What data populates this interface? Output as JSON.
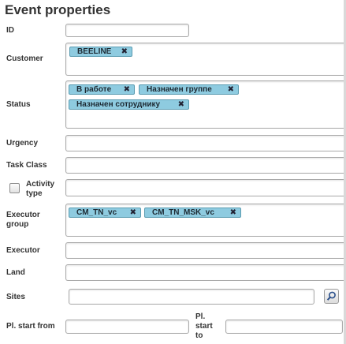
{
  "panel": {
    "title": "Event properties"
  },
  "fields": {
    "id": {
      "label": "ID",
      "value": ""
    },
    "customer": {
      "label": "Customer",
      "chips": [
        "BEELINE"
      ]
    },
    "status": {
      "label": "Status",
      "chips": [
        "В работе",
        "Назначен группе",
        "Назначен сотруднику"
      ]
    },
    "urgency": {
      "label": "Urgency",
      "value": ""
    },
    "task_class": {
      "label": "Task Class",
      "value": ""
    },
    "activity_type": {
      "label_line1": "Activity",
      "label_line2": "type",
      "checked": false,
      "value": ""
    },
    "executor_group": {
      "label_line1": "Executor",
      "label_line2": "group",
      "chips": [
        "CM_TN_vc",
        "CM_TN_MSK_vc"
      ]
    },
    "executor": {
      "label": "Executor",
      "value": ""
    },
    "land": {
      "label": "Land",
      "value": ""
    },
    "sites": {
      "label": "Sites",
      "value": "",
      "button_icon": "search-icon"
    },
    "pl_start_from": {
      "label": "Pl. start from",
      "value": ""
    },
    "pl_start_to": {
      "label_line1": "Pl.",
      "label_line2": "start",
      "label_line3": "to",
      "value": ""
    }
  },
  "chip_remove_glyph": "✖"
}
